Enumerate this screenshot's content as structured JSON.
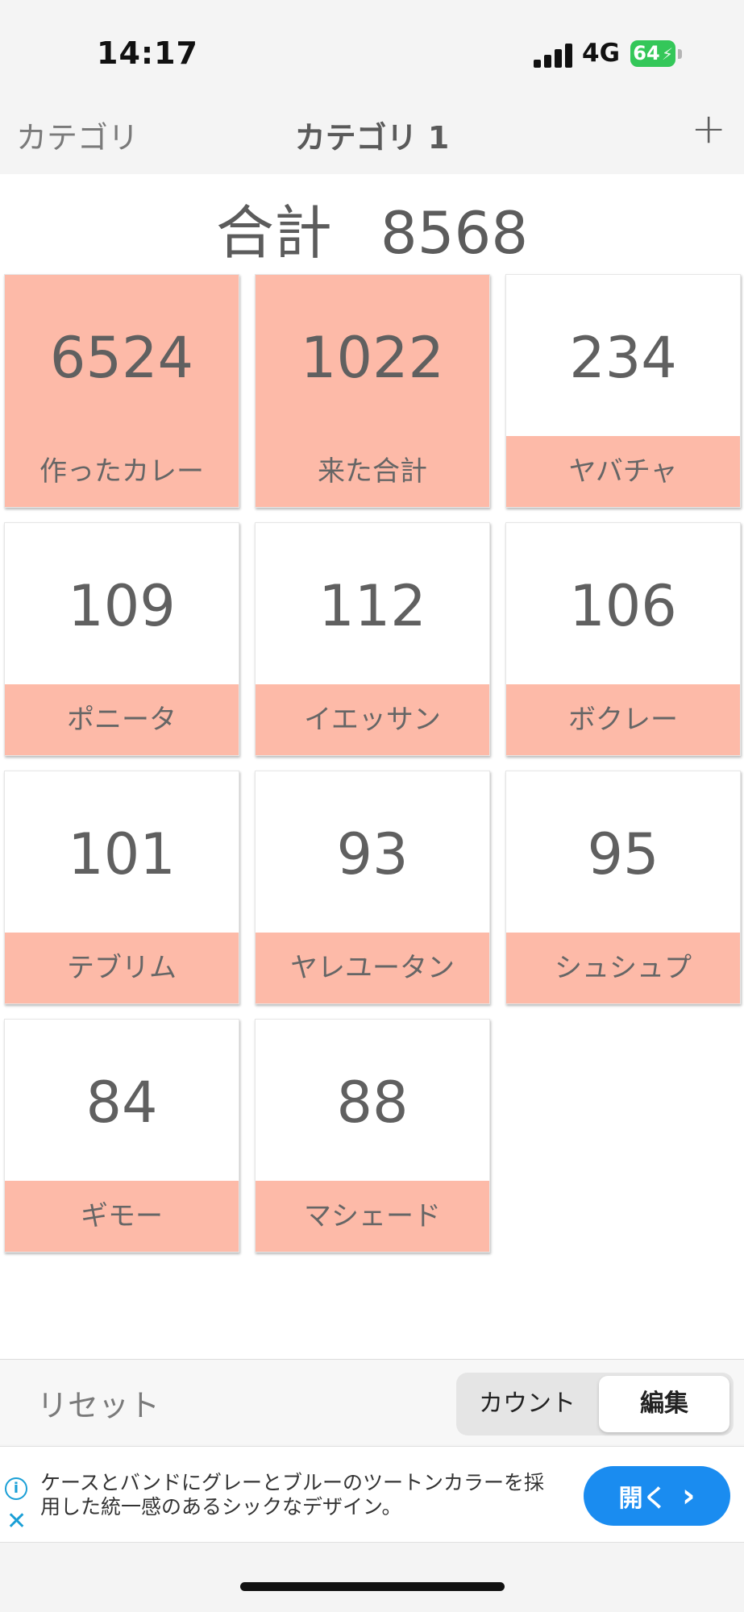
{
  "status_bar": {
    "time": "14:17",
    "network": "4G",
    "battery": "64"
  },
  "navbar": {
    "back_label": "カテゴリ",
    "title": "カテゴリ 1",
    "add_label": "+"
  },
  "total": {
    "label": "合計",
    "value": "8568"
  },
  "tiles": [
    {
      "value": "6524",
      "label": "作ったカレー",
      "filled": true
    },
    {
      "value": "1022",
      "label": "来た合計",
      "filled": true
    },
    {
      "value": "234",
      "label": "ヤバチャ",
      "filled": false
    },
    {
      "value": "109",
      "label": "ポニータ",
      "filled": false
    },
    {
      "value": "112",
      "label": "イエッサン",
      "filled": false
    },
    {
      "value": "106",
      "label": "ボクレー",
      "filled": false
    },
    {
      "value": "101",
      "label": "テブリム",
      "filled": false
    },
    {
      "value": "93",
      "label": "ヤレユータン",
      "filled": false
    },
    {
      "value": "95",
      "label": "シュシュプ",
      "filled": false
    },
    {
      "value": "84",
      "label": "ギモー",
      "filled": false
    },
    {
      "value": "88",
      "label": "マシェード",
      "filled": false
    }
  ],
  "toolbar": {
    "reset_label": "リセット",
    "mode_options": [
      "カウント",
      "編集"
    ],
    "selected_mode": "編集"
  },
  "ad": {
    "text": "ケースとバンドにグレーとブルーのツートンカラーを採用した統一感のあるシックなデザイン。",
    "button_label": "開く",
    "button_chevron": "›"
  },
  "colors": {
    "tile_accent": "#fdbaa8",
    "ad_button": "#1a8cf0",
    "battery": "#34c759"
  }
}
